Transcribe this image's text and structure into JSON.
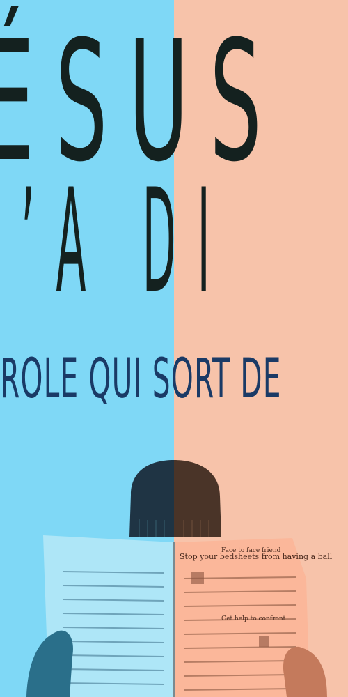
{
  "poster": {
    "title_line1": "ÉSUS",
    "title_line2": "’A DI",
    "subtitle": "ROLE QUI SORT DE"
  },
  "colors": {
    "left_background": "#7fd8f6",
    "right_background": "#f7c3aa",
    "title": "#14211f",
    "subtitle": "#1a3a66"
  },
  "newspaper": {
    "headline_1": "Stop your bedsheets from having a ball",
    "headline_2": "Face to face friend",
    "headline_3": "Get help to confront"
  }
}
